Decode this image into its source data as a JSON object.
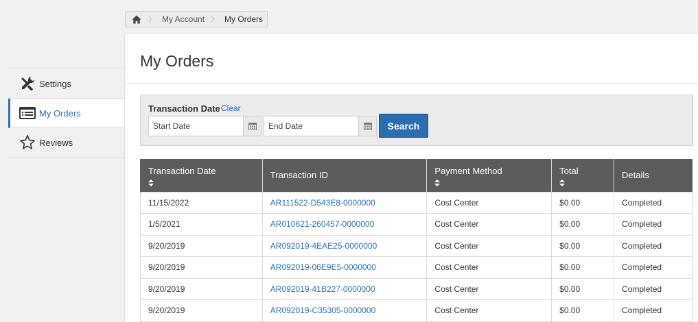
{
  "breadcrumb": {
    "home_icon": "home-icon",
    "items": [
      "My Account",
      "My Orders"
    ]
  },
  "sidebar": {
    "items": [
      {
        "label": "Settings",
        "icon": "tools-icon",
        "active": false
      },
      {
        "label": "My Orders",
        "icon": "orders-list-icon",
        "active": true
      },
      {
        "label": "Reviews",
        "icon": "star-icon",
        "active": false
      }
    ]
  },
  "page": {
    "title": "My Orders"
  },
  "filter": {
    "label": "Transaction Date",
    "clear_label": "Clear",
    "start_placeholder": "Start Date",
    "end_placeholder": "End Date",
    "search_label": "Search"
  },
  "table": {
    "headers": [
      {
        "label": "Transaction Date",
        "sortable": true
      },
      {
        "label": "Transaction ID",
        "sortable": false
      },
      {
        "label": "Payment Method",
        "sortable": true
      },
      {
        "label": "Total",
        "sortable": true
      },
      {
        "label": "Details",
        "sortable": false
      }
    ],
    "rows": [
      {
        "date": "11/15/2022",
        "id": "AR111522-D543E8-0000000",
        "method": "Cost Center",
        "total": "$0.00",
        "details": "Completed"
      },
      {
        "date": "1/5/2021",
        "id": "AR010621-260457-0000000",
        "method": "Cost Center",
        "total": "$0.00",
        "details": "Completed"
      },
      {
        "date": "9/20/2019",
        "id": "AR092019-4EAE25-0000000",
        "method": "Cost Center",
        "total": "$0.00",
        "details": "Completed"
      },
      {
        "date": "9/20/2019",
        "id": "AR092019-06E9E5-0000000",
        "method": "Cost Center",
        "total": "$0.00",
        "details": "Completed"
      },
      {
        "date": "9/20/2019",
        "id": "AR092019-41B227-0000000",
        "method": "Cost Center",
        "total": "$0.00",
        "details": "Completed"
      },
      {
        "date": "9/20/2019",
        "id": "AR092019-C35305-0000000",
        "method": "Cost Center",
        "total": "$0.00",
        "details": "Completed"
      }
    ]
  },
  "colors": {
    "accent": "#2a6fb3",
    "header_bg": "#5c5c5c",
    "button_bg": "#2b6db1"
  }
}
